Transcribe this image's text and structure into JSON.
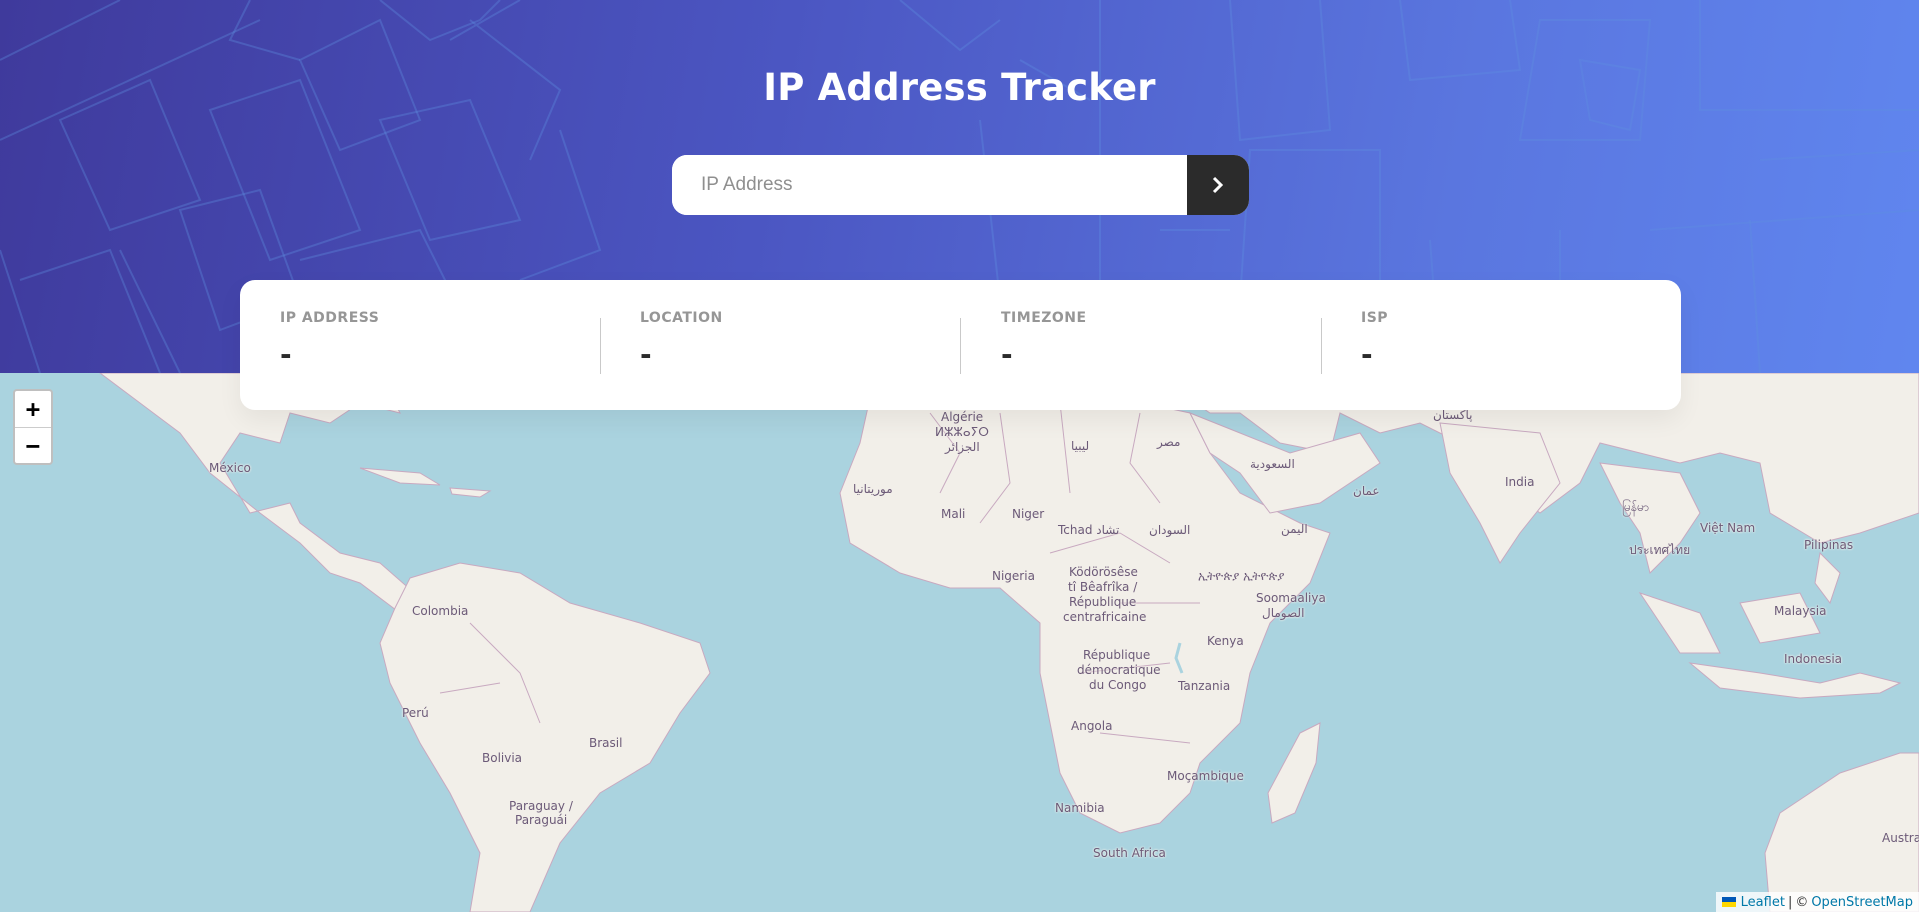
{
  "header": {
    "title": "IP Address Tracker",
    "search_placeholder": "IP Address",
    "search_value": "",
    "submit_icon": "chevron-right-icon"
  },
  "info": {
    "ip": {
      "label": "IP ADDRESS",
      "value": "-"
    },
    "location": {
      "label": "LOCATION",
      "value": "-"
    },
    "timezone": {
      "label": "TIMEZONE",
      "value": "-"
    },
    "isp": {
      "label": "ISP",
      "value": "-"
    }
  },
  "map": {
    "zoom_in": "+",
    "zoom_out": "−",
    "attribution_leaflet": "Leaflet",
    "attribution_sep": "|",
    "attribution_copy": "©",
    "attribution_osm": "OpenStreetMap",
    "labels": {
      "mexico": "México",
      "colombia": "Colombia",
      "peru": "Perú",
      "bolivia": "Bolivia",
      "brasil": "Brasil",
      "paraguay": "Paraguay /",
      "paraguai": "Paraguái",
      "algerie": "Algérie",
      "algerie_tif": "ⵍⵣⵣⴰⵢⵔ",
      "algerie_ar": "الجزائر",
      "libya": "ليبيا",
      "egypt": "مصر",
      "mauritania": "موريتانيا",
      "mali": "Mali",
      "niger": "Niger",
      "tchad": "Tchad تشاد",
      "sudan": "السودان",
      "saudi": "السعودية",
      "oman": "عمان",
      "yemen": "اليمن",
      "pakistan": "پاکستان",
      "india": "India",
      "myanmar": "မြန်မာ",
      "vietnam": "Việt Nam",
      "thailand": "ประเทศไทย",
      "pilipinas": "Pilipinas",
      "malaysia": "Malaysia",
      "indonesia": "Indonesia",
      "nigeria": "Nigeria",
      "car1": "Ködörösêse",
      "car2": "tî Bêafrîka /",
      "car3": "République",
      "car4": "centrafricaine",
      "ethiopia": "ኢትዮጵያ ኢትዮጵያ",
      "somalia": "Soomaaliya",
      "somalia_ar": "الصومال",
      "kenya": "Kenya",
      "drc1": "République",
      "drc2": "démocratique",
      "drc3": "du Congo",
      "tanzania": "Tanzania",
      "angola": "Angola",
      "mocambique": "Moçambique",
      "namibia": "Namibia",
      "south_africa": "South Africa",
      "australia": "Austra"
    }
  }
}
